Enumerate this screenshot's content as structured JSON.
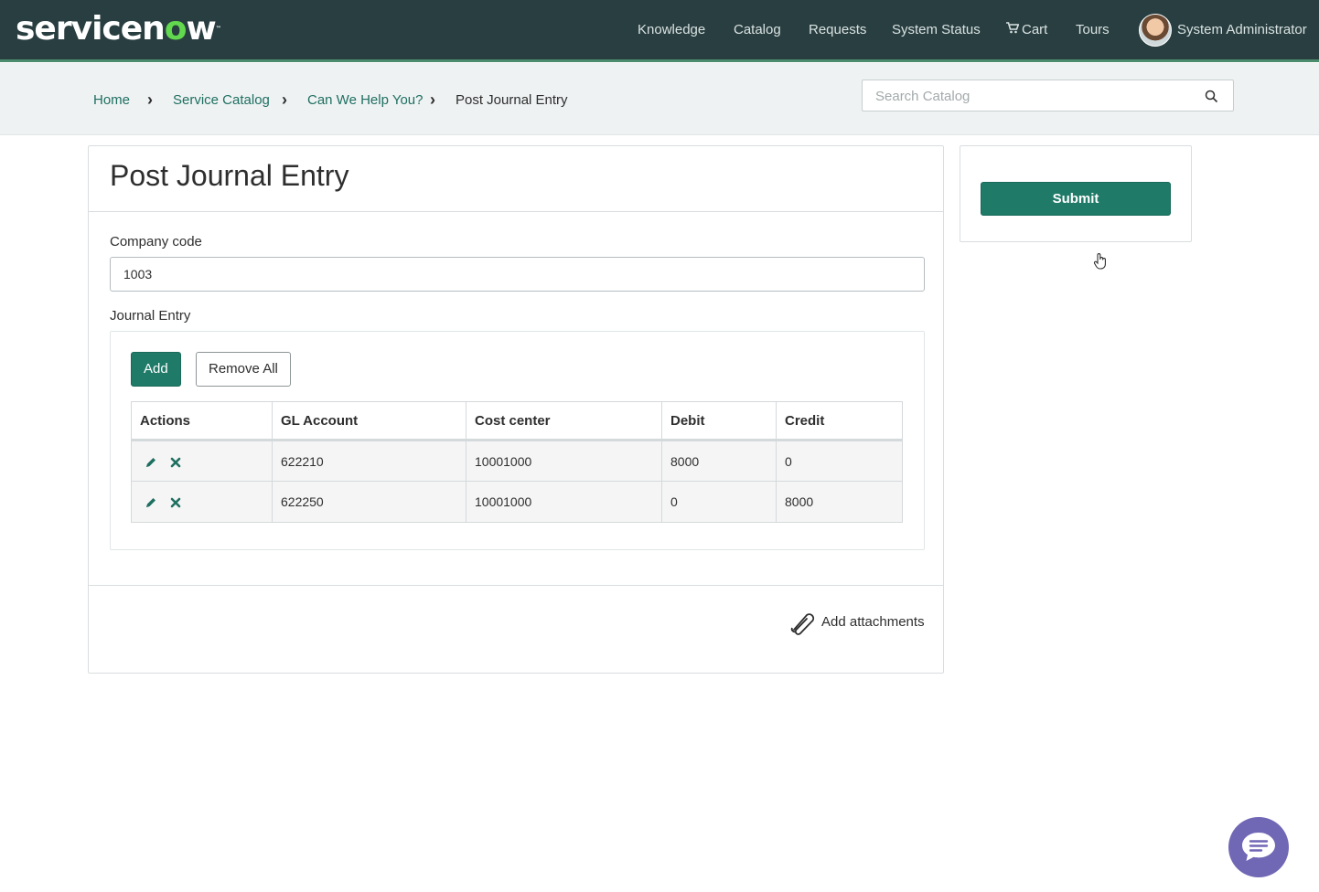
{
  "header": {
    "logo_text_1": "servicen",
    "logo_text_o": "o",
    "logo_text_2": "w",
    "logo_tm": "™",
    "nav": {
      "knowledge": "Knowledge",
      "catalog": "Catalog",
      "requests": "Requests",
      "system_status": "System Status",
      "cart": "Cart",
      "tours": "Tours",
      "user": "System Administrator"
    }
  },
  "breadcrumb": {
    "home": "Home",
    "service_catalog": "Service Catalog",
    "help": "Can We Help You?",
    "current": "Post Journal Entry"
  },
  "search": {
    "placeholder": "Search Catalog"
  },
  "form": {
    "title": "Post Journal Entry",
    "company_code_label": "Company code",
    "company_code_value": "1003",
    "journal_entry_label": "Journal Entry",
    "add_label": "Add",
    "remove_all_label": "Remove All",
    "columns": {
      "actions": "Actions",
      "gl_account": "GL Account",
      "cost_center": "Cost center",
      "debit": "Debit",
      "credit": "Credit"
    },
    "rows": [
      {
        "gl_account": "622210",
        "cost_center": "10001000",
        "debit": "8000",
        "credit": "0"
      },
      {
        "gl_account": "622250",
        "cost_center": "10001000",
        "debit": "0",
        "credit": "8000"
      }
    ],
    "attachments_label": "Add attachments"
  },
  "sidebar": {
    "submit_label": "Submit"
  },
  "colors": {
    "nav_bg": "#293e40",
    "accent": "#1f7a68",
    "chat": "#7067b5"
  }
}
